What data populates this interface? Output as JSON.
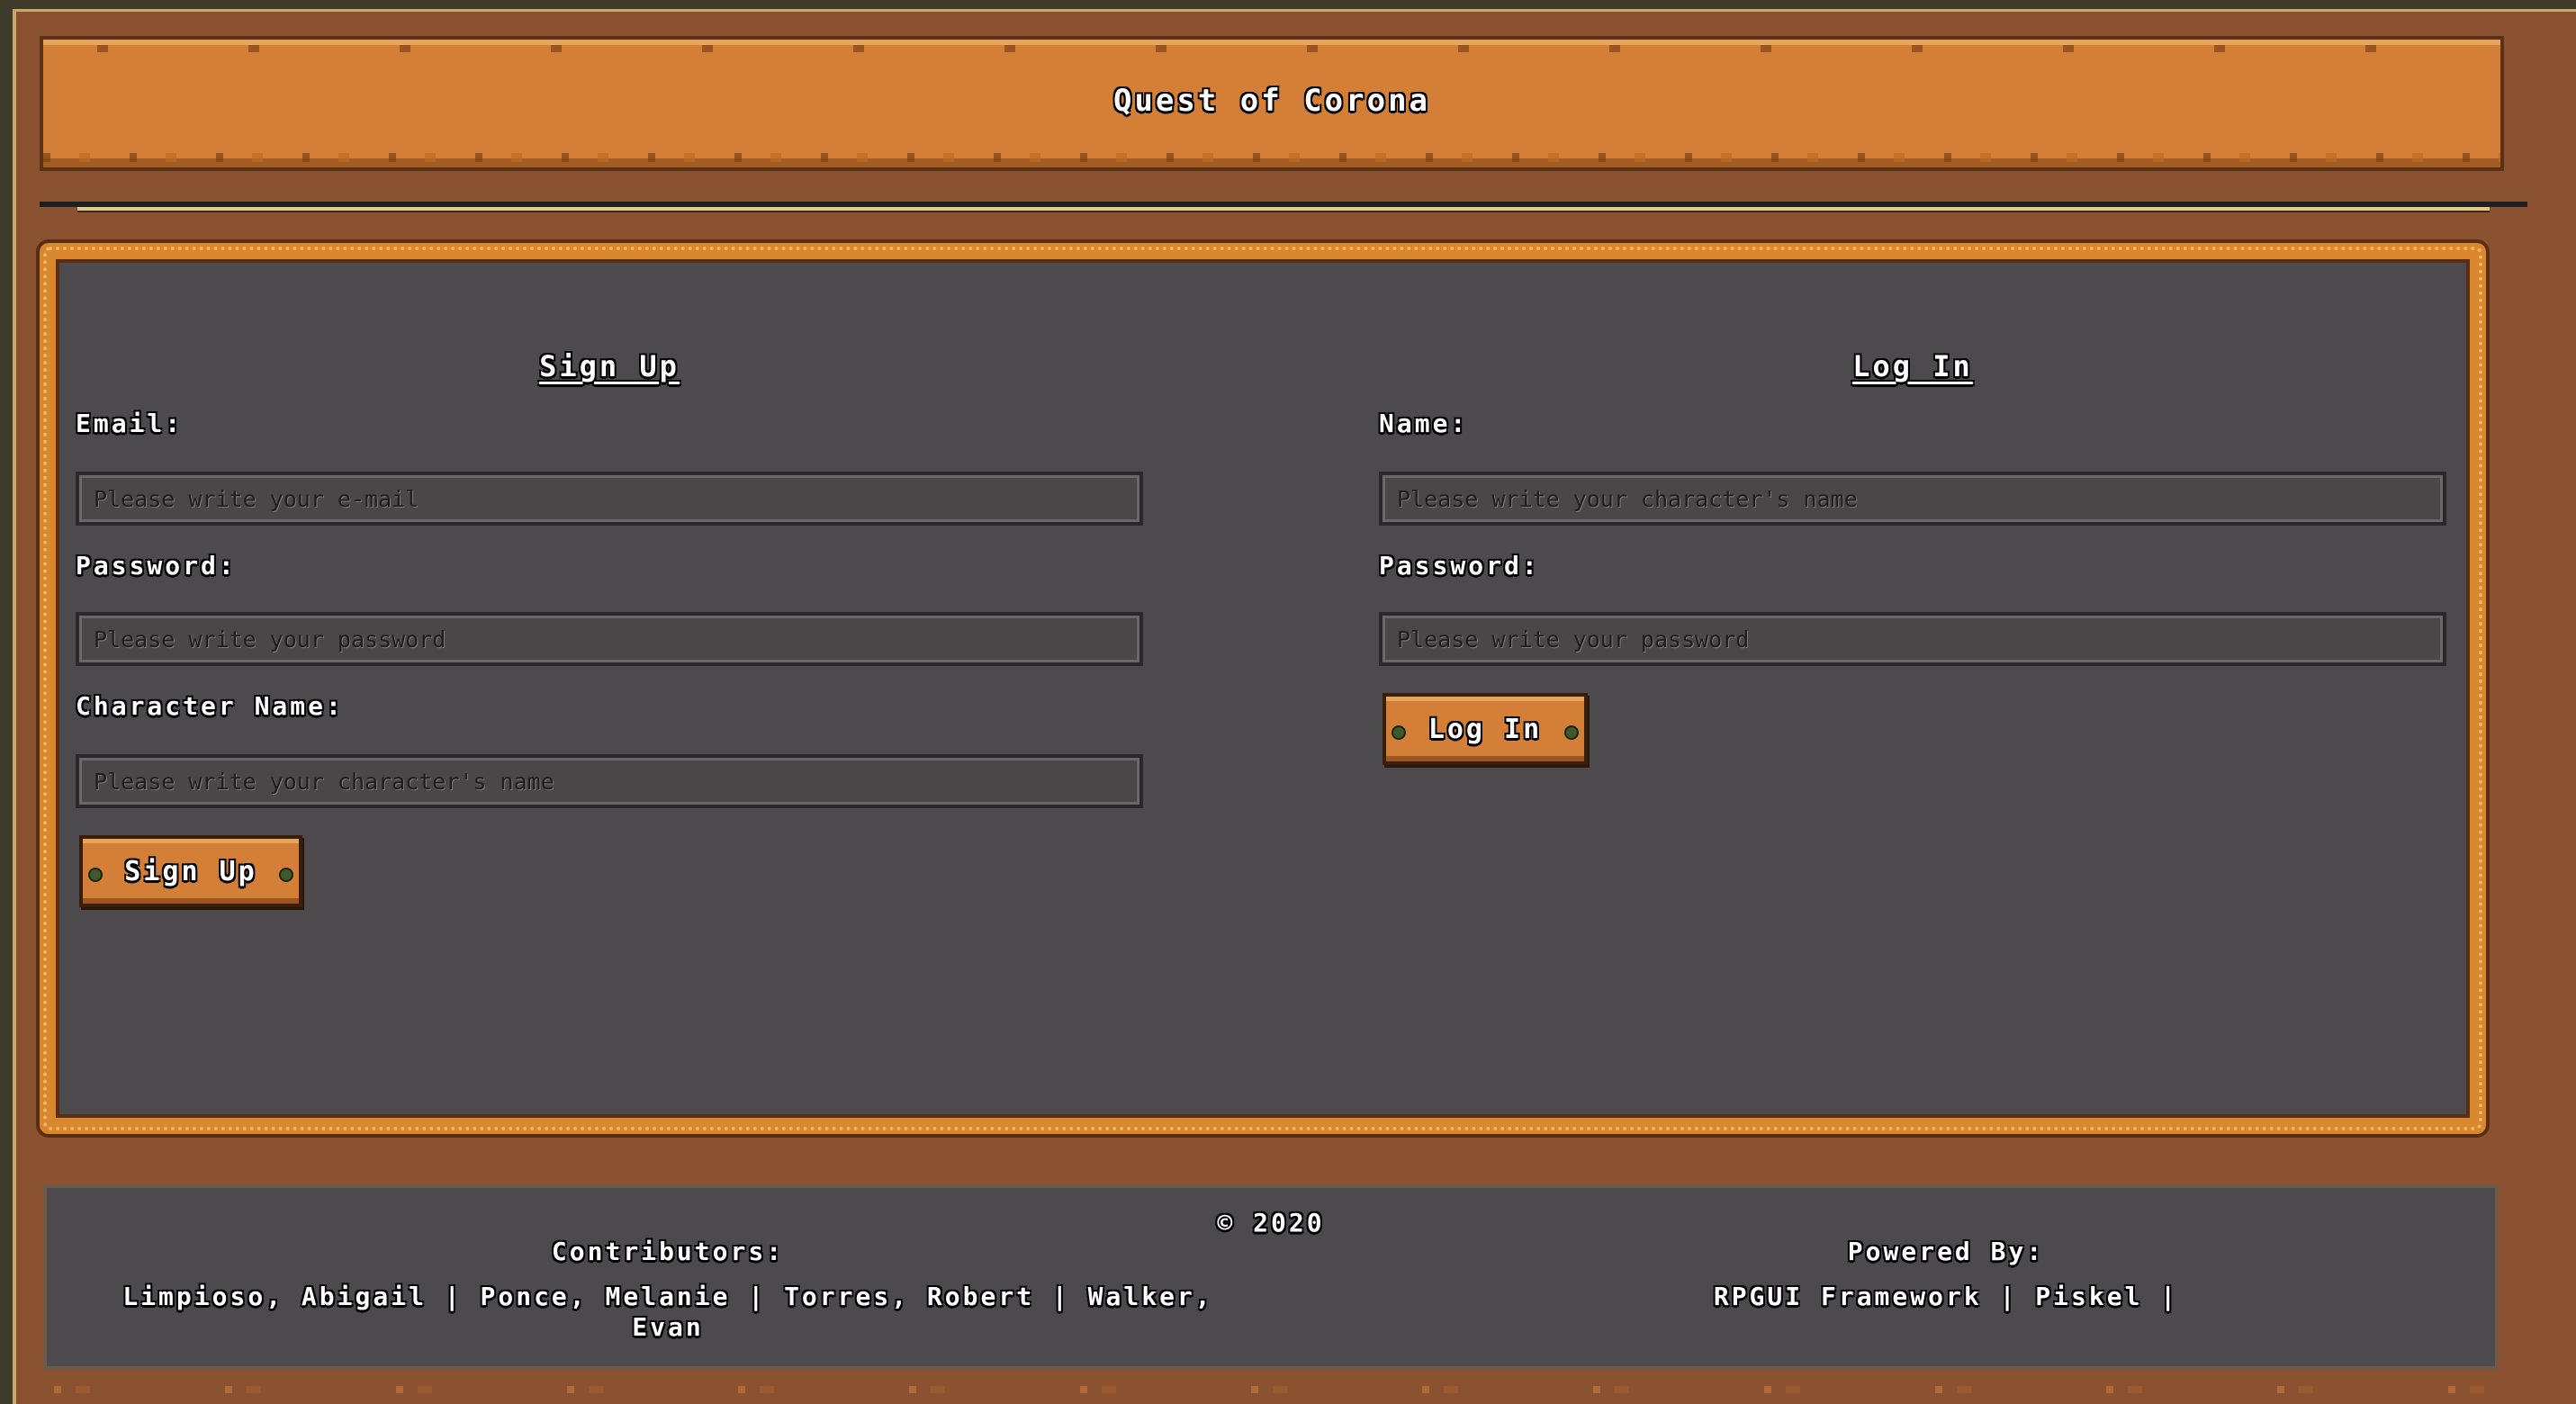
{
  "header": {
    "title": "Quest of Corona"
  },
  "signup": {
    "title": "Sign Up",
    "email_label": "Email:",
    "email_placeholder": "Please write your e-mail",
    "password_label": "Password:",
    "password_placeholder": "Please write your password",
    "character_label": "Character Name:",
    "character_placeholder": "Please write your character's name",
    "button_label": "Sign Up"
  },
  "login": {
    "title": "Log In",
    "name_label": "Name:",
    "name_placeholder": "Please write your character's name",
    "password_label": "Password:",
    "password_placeholder": "Please write your password",
    "button_label": "Log In"
  },
  "footer": {
    "copyright": "© 2020",
    "contributors_heading": "Contributors:",
    "contributors": "Limpioso, Abigail | Ponce, Melanie | Torres, Robert | Walker, Evan",
    "powered_heading": "Powered By:",
    "powered": "RPGUI Framework | Piskel |"
  },
  "colors": {
    "frame": "#8b5232",
    "accent": "#d47f37",
    "panel": "#4d4a4e"
  }
}
